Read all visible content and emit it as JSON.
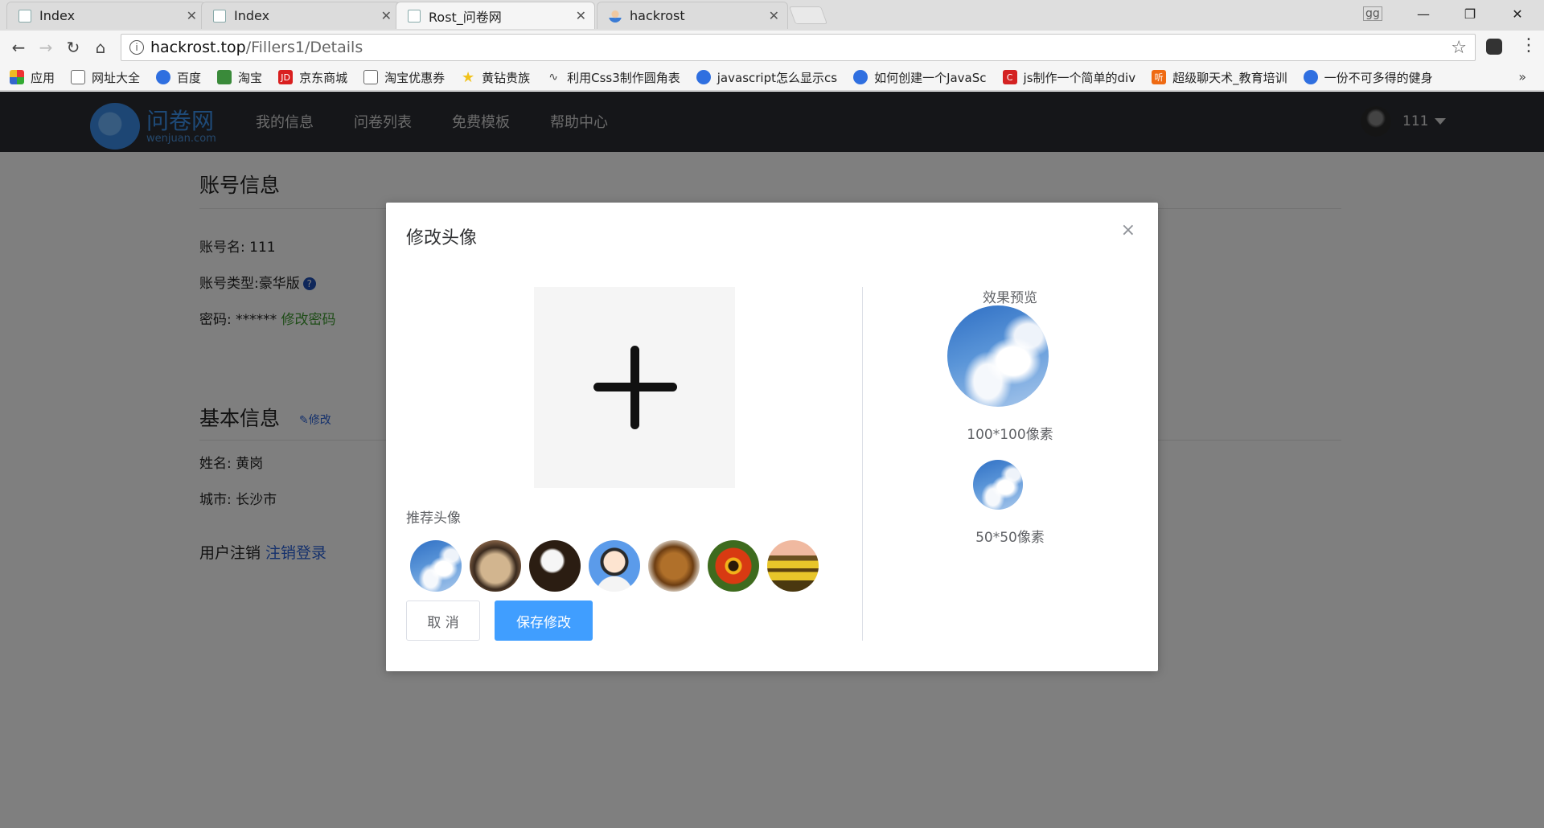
{
  "browser": {
    "tabs": [
      {
        "title": "Index"
      },
      {
        "title": "Index"
      },
      {
        "title": "Rost_问卷网"
      },
      {
        "title": "hackrost"
      }
    ],
    "address": {
      "host": "hackrost.top",
      "path": "/Fillers1/Details"
    },
    "profile_badge": "gg",
    "bookmarks": [
      {
        "label": "应用",
        "icon": "apps-grid-icon"
      },
      {
        "label": "网址大全",
        "icon": "page-icon"
      },
      {
        "label": "百度",
        "icon": "baidu-paw-icon"
      },
      {
        "label": "淘宝",
        "icon": "taobao-icon"
      },
      {
        "label": "京东商城",
        "icon": "jd-icon"
      },
      {
        "label": "淘宝优惠券",
        "icon": "page-icon"
      },
      {
        "label": "黄钻贵族",
        "icon": "star-icon"
      },
      {
        "label": "利用Css3制作圆角表",
        "icon": "feather-icon"
      },
      {
        "label": "javascript怎么显示cs",
        "icon": "baidu-paw-icon"
      },
      {
        "label": "如何创建一个JavaSc",
        "icon": "baidu-paw-icon"
      },
      {
        "label": "js制作一个简单的div",
        "icon": "csdn-icon"
      },
      {
        "label": "超级聊天术_教育培训",
        "icon": "tingting-icon"
      },
      {
        "label": "一份不可多得的健身",
        "icon": "baidu-paw-icon"
      }
    ],
    "more_bookmarks": "»"
  },
  "site": {
    "logo": {
      "cn": "问卷网",
      "en": "wenjuan.com"
    },
    "nav": [
      "我的信息",
      "问卷列表",
      "免费模板",
      "帮助中心"
    ],
    "user": {
      "name": "111"
    }
  },
  "account": {
    "title": "账号信息",
    "name_label": "账号名: ",
    "name_value": "111",
    "type_label": "账号类型:",
    "type_value": "豪华版",
    "help": "?",
    "password_label": "密码: ",
    "password_value": "******",
    "change_password": "修改密码"
  },
  "basic": {
    "title": "基本信息",
    "edit": "✎修改",
    "name_label": "姓名: ",
    "name_value": "黄岗",
    "city_label": "城市: ",
    "city_value": "长沙市",
    "logout_label": "用户注销 ",
    "logout_link": "注销登录"
  },
  "modal": {
    "title": "修改头像",
    "close": "×",
    "recommended_label": "推荐头像",
    "recommended": [
      "sky",
      "pug",
      "eagle",
      "cartoon-man",
      "horse",
      "flower",
      "tulip-field"
    ],
    "cancel": "取 消",
    "save": "保存修改",
    "preview_title": "效果预览",
    "size_large": "100*100像素",
    "size_small": "50*50像素"
  },
  "colors": {
    "primary": "#409eff",
    "header_bg": "#2a2d33",
    "link_green": "#3f9a31",
    "link_blue": "#2b62d9"
  }
}
